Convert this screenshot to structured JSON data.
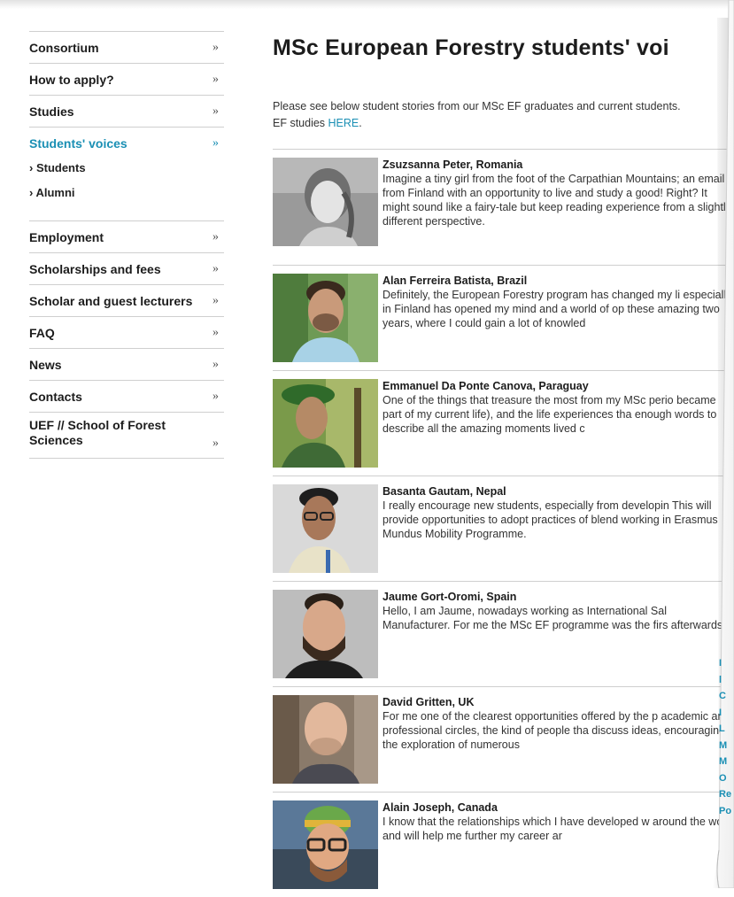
{
  "sidebar": {
    "items": [
      {
        "label": "Consortium",
        "chevron": "»"
      },
      {
        "label": "How to apply?",
        "chevron": "»"
      },
      {
        "label": "Studies",
        "chevron": "»"
      },
      {
        "label": "Students' voices",
        "chevron": "»",
        "active": true
      },
      {
        "label": "Employment",
        "chevron": "»"
      },
      {
        "label": "Scholarships and fees",
        "chevron": "»"
      },
      {
        "label": "Scholar and guest lecturers",
        "chevron": "»"
      },
      {
        "label": "FAQ",
        "chevron": "»"
      },
      {
        "label": "News",
        "chevron": "»"
      },
      {
        "label": "Contacts",
        "chevron": "»"
      },
      {
        "label": "UEF // School of Forest Sciences",
        "chevron": "»"
      }
    ],
    "sub_items": [
      "› Students",
      "› Alumni"
    ]
  },
  "main": {
    "title": "MSc European Forestry students' voi",
    "intro_text": "Please see below student stories from our MSc EF graduates and current students.",
    "intro_text_2": "EF studies ",
    "intro_link": "HERE",
    "intro_end": ".",
    "stories": [
      {
        "name": "Zsuzsanna Peter, Romania",
        "excerpt": "Imagine a tiny girl from the foot of the Carpathian Mountains; an email from Finland with an opportunity to live and study a good! Right? It might sound like a fairy-tale but keep reading experience from a slightly different perspective."
      },
      {
        "name": "Alan Ferreira Batista, Brazil",
        "excerpt": "Definitely, the European Forestry program has changed my li especially in Finland has opened my mind and a world of op these amazing two years, where I could gain a lot of knowled"
      },
      {
        "name": "Emmanuel Da Ponte Canova, Paraguay",
        "excerpt": "One of the things that treasure the most from my MSc perio became part of my current life), and the life experiences tha enough words to describe all the amazing moments lived c"
      },
      {
        "name": "Basanta Gautam, Nepal",
        "excerpt": "I really encourage new students, especially from developin This will provide opportunities to adopt practices of blend working in Erasmus Mundus Mobility Programme."
      },
      {
        "name": "Jaume Gort-Oromi, Spain",
        "excerpt": "Hello, I am Jaume, nowadays working as International Sal Manufacturer. For me the MSc EF programme was the firs afterwards."
      },
      {
        "name": "David Gritten, UK",
        "excerpt": "For me one of the clearest opportunities offered by the p academic and professional circles, the kind of people tha discuss ideas, encouraging the exploration of numerous"
      },
      {
        "name": "Alain Joseph, Canada",
        "excerpt": "I know that the relationships which I have developed w around the world and will help me further my career ar"
      }
    ]
  },
  "curl_page": {
    "fragments": [
      "I",
      "l",
      "C",
      "I",
      "L",
      "M",
      "M",
      "O",
      "Re",
      "Po"
    ]
  },
  "colors": {
    "accent": "#1a8fb4",
    "text": "#1c1c1c",
    "divider": "#cfcfcf"
  }
}
